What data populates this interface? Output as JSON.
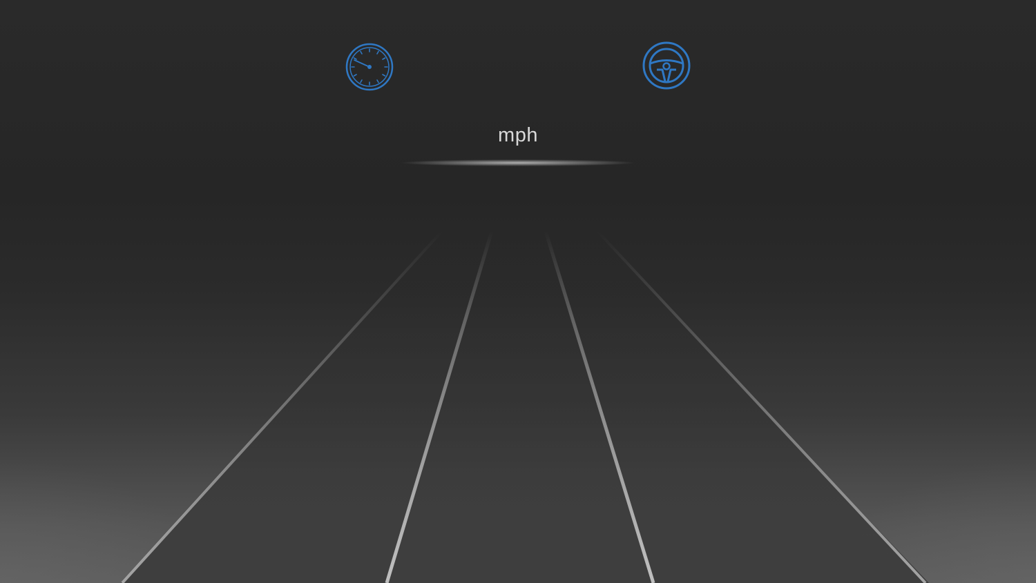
{
  "cluster": {
    "speed_unit": "mph",
    "speed_value": "",
    "accent_color": "#2f78c4"
  },
  "icons": {
    "left": "speedometer-icon",
    "right": "steering-wheel-icon"
  }
}
